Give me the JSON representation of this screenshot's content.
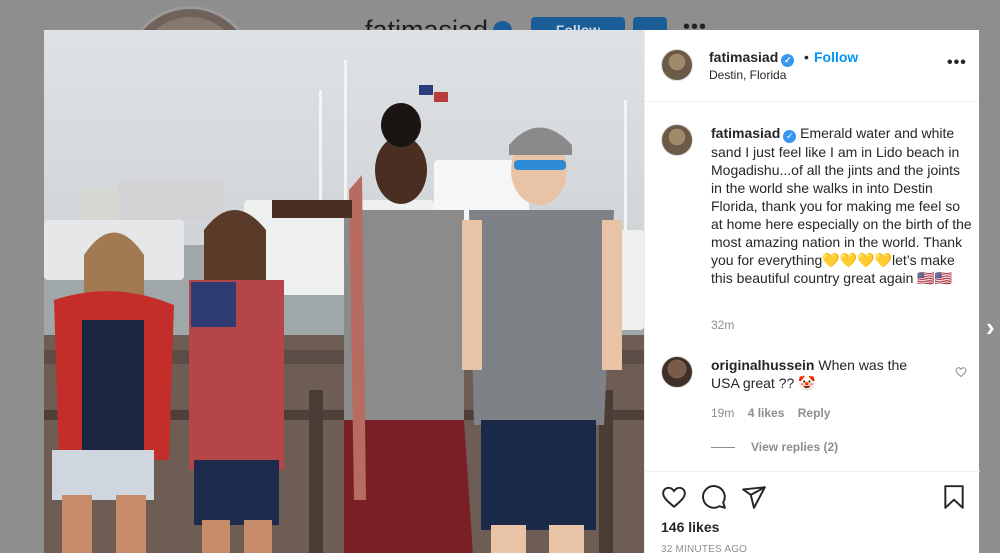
{
  "background_profile": {
    "username": "fatimasiad",
    "follow_label": "Follow"
  },
  "post": {
    "header": {
      "username": "fatimasiad",
      "separator": "•",
      "follow_label": "Follow",
      "location": "Destin, Florida",
      "more_icon": "more-dots-icon"
    },
    "caption": {
      "username": "fatimasiad",
      "text": "Emerald water and white sand I just feel like I am in Lido beach in Mogadishu...of all the jints and the joints in the world she walks in into Destin Florida, thank you for making me feel so at home here especially on the birth of the most amazing nation in the world. Thank you for everything💛💛💛💛let’s make this beautiful country great again 🇺🇸🇺🇸",
      "time": "32m"
    },
    "comments": [
      {
        "username": "originalhussein",
        "text": "When was the USA great ?? 🤡",
        "time": "19m",
        "likes": "4 likes",
        "reply_label": "Reply",
        "view_replies": "View replies (2)"
      }
    ],
    "likes_count": "146 likes",
    "time_ago": "32 MINUTES AGO"
  },
  "colors": {
    "accent": "#0095f6",
    "verified": "#3897f0",
    "muted": "#8e8e8e",
    "text": "#262626"
  }
}
